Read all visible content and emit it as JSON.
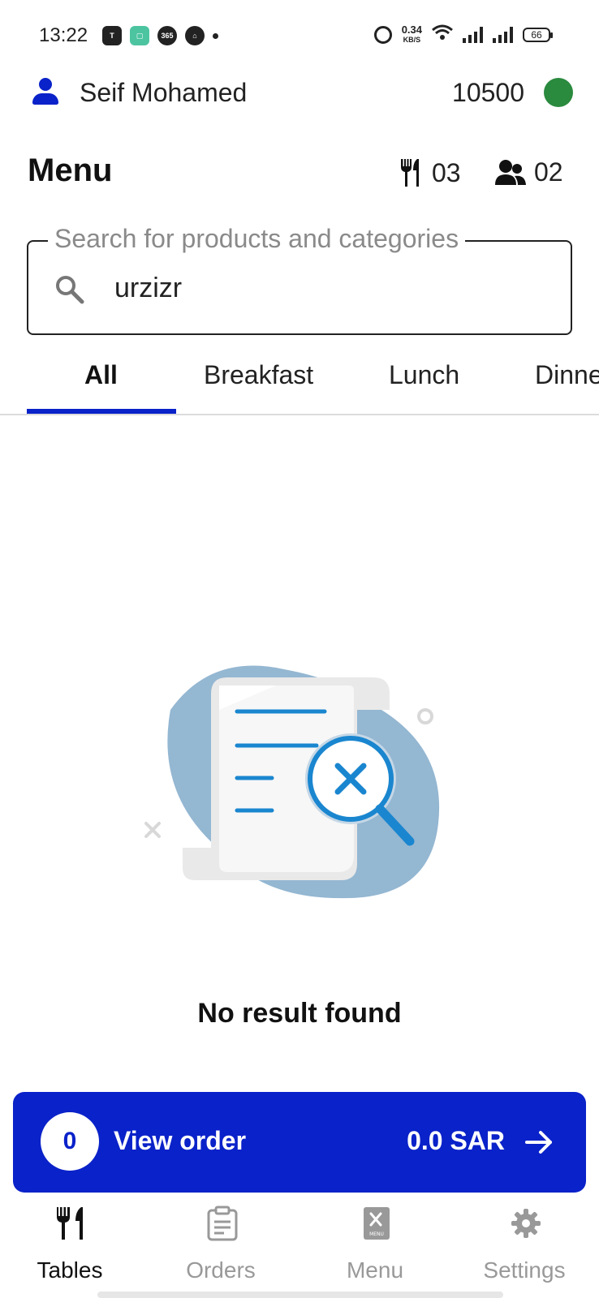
{
  "status_bar": {
    "time": "13:22",
    "notification_icons": [
      "teams-icon",
      "multitask-icon",
      "365-icon",
      "mosque-icon"
    ],
    "ms365_label": "365",
    "net_speed_value": "0.34",
    "net_speed_unit": "KB/S",
    "battery": "66"
  },
  "header": {
    "user_name": "Seif Mohamed",
    "balance": "10500",
    "status_color": "#2a8a3e"
  },
  "page": {
    "title": "Menu",
    "tables_count": "03",
    "guests_count": "02"
  },
  "search": {
    "placeholder": "Search for products and categories",
    "value": "urzizr"
  },
  "tabs": [
    {
      "label": "All",
      "active": true
    },
    {
      "label": "Breakfast",
      "active": false
    },
    {
      "label": "Lunch",
      "active": false
    },
    {
      "label": "Dinner",
      "active": false
    }
  ],
  "empty_state": {
    "message": "No result found"
  },
  "order_bar": {
    "count": "0",
    "label": "View order",
    "total": "0.0 SAR"
  },
  "bottom_nav": [
    {
      "label": "Tables",
      "icon": "cutlery-icon",
      "active": true
    },
    {
      "label": "Orders",
      "icon": "clipboard-icon",
      "active": false
    },
    {
      "label": "Menu",
      "icon": "menu-book-icon",
      "active": false,
      "icon_caption": "MENU"
    },
    {
      "label": "Settings",
      "icon": "gear-icon",
      "active": false
    }
  ],
  "colors": {
    "accent": "#0a22c9",
    "illustration_blob": "#94b7d2",
    "illustration_lines": "#1a86cf"
  }
}
